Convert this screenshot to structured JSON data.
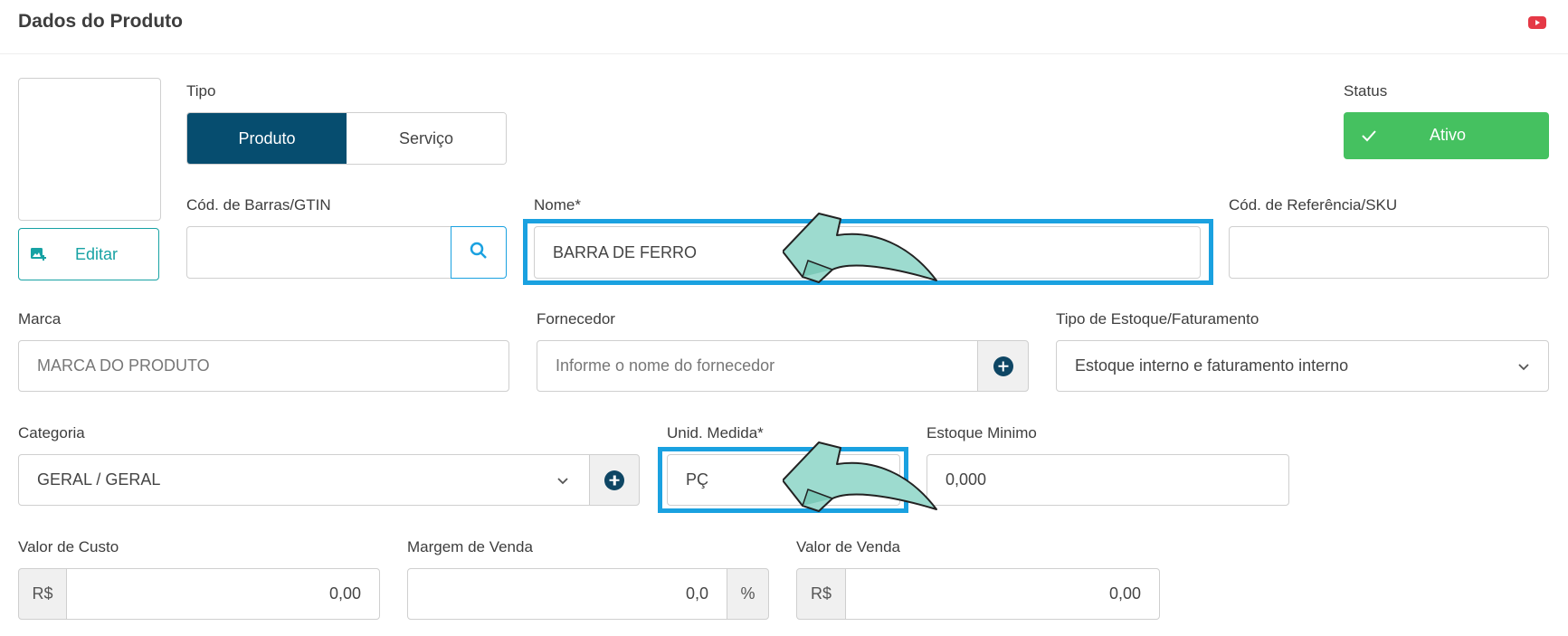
{
  "header": {
    "title": "Dados do Produto",
    "video_icon": "youtube-icon",
    "video_color": "#e53946"
  },
  "image": {
    "edit_label": "Editar",
    "edit_icon": "image-add-icon"
  },
  "tipo": {
    "label": "Tipo",
    "options": [
      "Produto",
      "Serviço"
    ],
    "selected": "Produto"
  },
  "status": {
    "label": "Status",
    "value": "Ativo",
    "color": "#45c160"
  },
  "barcode": {
    "label": "Cód. de Barras/GTIN",
    "value": "",
    "search_icon": "search-icon"
  },
  "nome": {
    "label": "Nome*",
    "value": "BARRA DE FERRO"
  },
  "sku": {
    "label": "Cód. de Referência/SKU",
    "value": ""
  },
  "marca": {
    "label": "Marca",
    "placeholder": "MARCA DO PRODUTO"
  },
  "fornecedor": {
    "label": "Fornecedor",
    "placeholder": "Informe o nome do fornecedor",
    "add_icon": "plus-circle-icon"
  },
  "tipo_estoque": {
    "label": "Tipo de Estoque/Faturamento",
    "value": "Estoque interno e faturamento interno"
  },
  "categoria": {
    "label": "Categoria",
    "value": "GERAL / GERAL",
    "add_icon": "plus-circle-icon"
  },
  "unidade": {
    "label": "Unid. Medida*",
    "value": "PÇ"
  },
  "estoque_minimo": {
    "label": "Estoque Minimo",
    "value": "0,000"
  },
  "valor_custo": {
    "label": "Valor de Custo",
    "prefix": "R$",
    "value": "0,00"
  },
  "margem": {
    "label": "Margem de Venda",
    "value": "0,0",
    "suffix": "%"
  },
  "valor_venda": {
    "label": "Valor de Venda",
    "prefix": "R$",
    "value": "0,00"
  },
  "colors": {
    "primary": "#064d6f",
    "teal": "#17a2a4",
    "highlight": "#1aa1e0",
    "arrow": "#9ddbcf"
  }
}
